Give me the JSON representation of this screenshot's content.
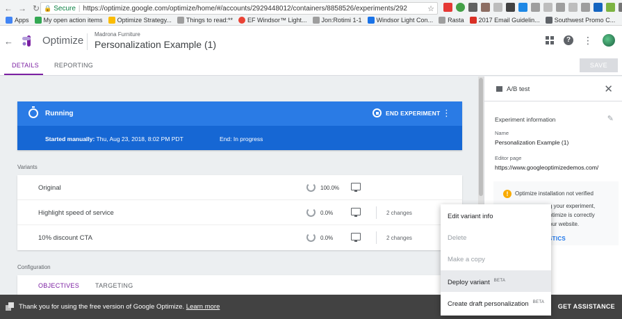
{
  "browser": {
    "secure_label": "Secure",
    "url": "https://optimize.google.com/optimize/home/#/accounts/2929448012/containers/8858526/experiments/292",
    "bookmarks": [
      {
        "label": "Apps",
        "color": "#4285f4"
      },
      {
        "label": "My open action items",
        "color": "#34a853"
      },
      {
        "label": "Optimize Strategy...",
        "color": "#fbbc04"
      },
      {
        "label": "Things to read:**",
        "color": "#9e9e9e"
      },
      {
        "label": "EF Windsor™ Light...",
        "color": "#ea4335"
      },
      {
        "label": "Jon:Rotimi 1-1",
        "color": "#9e9e9e"
      },
      {
        "label": "Windsor Light Con...",
        "color": "#1a73e8"
      },
      {
        "label": "Rasta",
        "color": "#9e9e9e"
      },
      {
        "label": "2017 Email Guidelin...",
        "color": "#d93025"
      },
      {
        "label": "Southwest Promo C...",
        "color": "#5f6368"
      }
    ]
  },
  "header": {
    "app_name": "Optimize",
    "container_name": "Madrona Furniture",
    "experiment_title": "Personalization Example (1)"
  },
  "tabs": [
    {
      "label": "DETAILS",
      "active": true
    },
    {
      "label": "REPORTING",
      "active": false
    }
  ],
  "save_label": "SAVE",
  "status_card": {
    "status": "Running",
    "end_label": "END EXPERIMENT",
    "started_label": "Started manually:",
    "started_value": "Thu, Aug 23, 2018, 8:02 PM PDT",
    "end_status": "End: In progress"
  },
  "variants_label": "Variants",
  "variants": [
    {
      "name": "Original",
      "weight": "100.0%",
      "changes": ""
    },
    {
      "name": "Highlight speed of service",
      "weight": "0.0%",
      "changes": "2 changes"
    },
    {
      "name": "10% discount CTA",
      "weight": "0.0%",
      "changes": "2 changes"
    }
  ],
  "configuration_label": "Configuration",
  "config_tabs": [
    {
      "label": "OBJECTIVES",
      "active": true
    },
    {
      "label": "TARGETING",
      "active": false
    }
  ],
  "panel": {
    "title": "A/B test",
    "info_title": "Experiment information",
    "name_label": "Name",
    "name_value": "Personalization Example (1)",
    "editor_label": "Editor page",
    "editor_value": "https://www.googleoptimizedemos.com/",
    "warning_title": "Optimize installation not verified",
    "warning_lines": [
      "g your experiment,",
      "ptimize is correctly",
      "our website."
    ],
    "warning_link": "STICS"
  },
  "menu": [
    {
      "label": "Edit variant info",
      "disabled": false,
      "badge": ""
    },
    {
      "label": "Delete",
      "disabled": true,
      "badge": ""
    },
    {
      "label": "Make a copy",
      "disabled": true,
      "badge": ""
    },
    {
      "label": "Deploy variant",
      "disabled": false,
      "badge": "BETA"
    },
    {
      "label": "Create draft personalization",
      "disabled": false,
      "badge": "BETA"
    }
  ],
  "bottom_bar": {
    "message": "Thank you for using the free version of Google Optimize.",
    "link": "Learn more",
    "assist": "GET ASSISTANCE"
  },
  "colors": {
    "accent": "#7b1fa2",
    "running_blue": "#1a73e8",
    "warning": "#f9ab00"
  }
}
